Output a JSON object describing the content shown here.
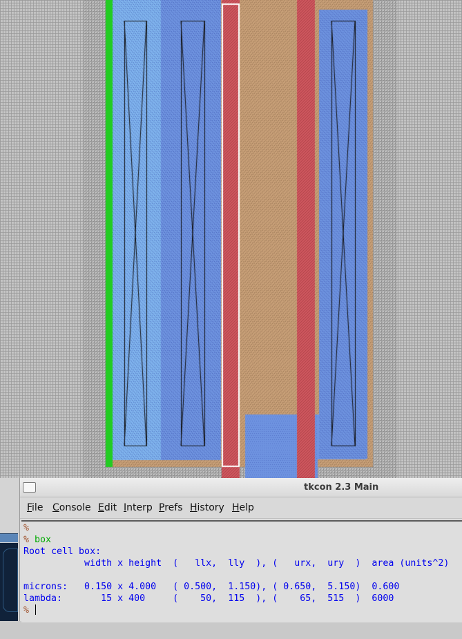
{
  "layout_view": {
    "colors": {
      "background": "#c9c9c9",
      "grid": "#9a9a9a",
      "hatch": "#333333",
      "diffusion_blue": "#6f94e0",
      "light_blue": "#80b4ee",
      "poly_red": "#d05860",
      "ndiff_tan": "#c8a078",
      "nwell_green": "#22cc22",
      "selection_box": "#ffffff"
    }
  },
  "window": {
    "title": "tkcon 2.3 Main",
    "icon": "window-menu-icon"
  },
  "menu": [
    {
      "label": "File",
      "key": "F"
    },
    {
      "label": "Console",
      "key": "C"
    },
    {
      "label": "Edit",
      "key": "E"
    },
    {
      "label": "Interp",
      "key": "I"
    },
    {
      "label": "Prefs",
      "key": "P"
    },
    {
      "label": "History",
      "key": "H"
    },
    {
      "label": "Help",
      "key": "H"
    }
  ],
  "console": {
    "prompt": "%",
    "command": "box",
    "output": [
      "Root cell box:",
      "           width x height  (   llx,  lly  ), (   urx,  ury  )  area (units^2)",
      "",
      "microns:   0.150 x 4.000   ( 0.500,  1.150), ( 0.650,  5.150)  0.600",
      "lambda:       15 x 400     (    50,  115  ), (    65,  515  )  6000"
    ]
  }
}
